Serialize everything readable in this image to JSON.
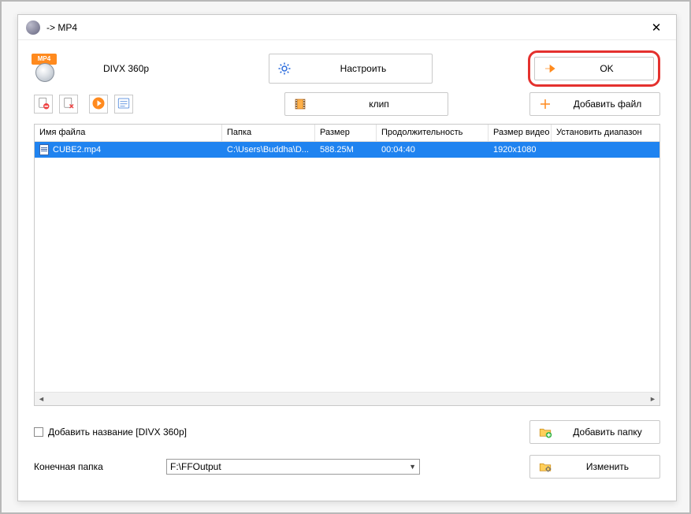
{
  "window": {
    "title": "-> MP4"
  },
  "preset": {
    "label": "DIVX 360p",
    "iconText": "MP4"
  },
  "buttons": {
    "setup": "Настроить",
    "ok": "OK",
    "clip": "клип",
    "addFile": "Добавить файл",
    "addFolder": "Добавить папку",
    "change": "Изменить"
  },
  "table": {
    "headers": {
      "name": "Имя файла",
      "folder": "Папка",
      "size": "Размер",
      "duration": "Продолжительность",
      "videoSize": "Размер видео",
      "setRange": "Установить диапазон"
    },
    "rows": [
      {
        "name": "CUBE2.mp4",
        "folder": "C:\\Users\\Buddha\\D...",
        "size": "588.25M",
        "duration": "00:04:40",
        "videoSize": "1920x1080",
        "range": ""
      }
    ]
  },
  "checkbox": {
    "label": "Добавить название [DIVX 360p]"
  },
  "output": {
    "label": "Конечная папка",
    "path": "F:\\FFOutput"
  }
}
